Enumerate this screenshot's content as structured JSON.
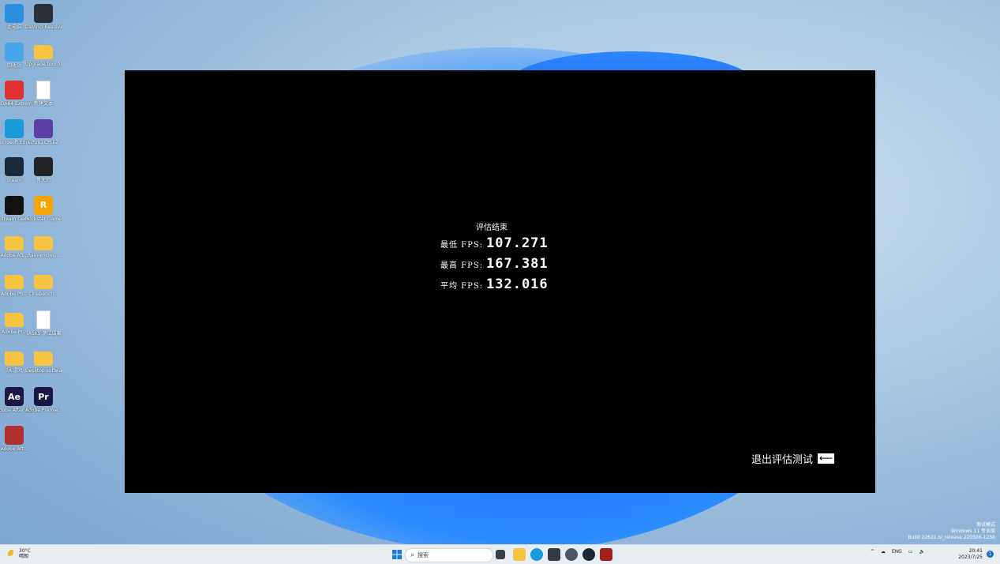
{
  "desktop_icons": [
    {
      "label": "此电脑",
      "icon": "computer-icon",
      "color": "#2b8fe0"
    },
    {
      "label": "DaVinci Resolve",
      "icon": "davinci-icon",
      "color": "#2a2f3a"
    },
    {
      "label": "回收站",
      "icon": "recycle-bin-icon",
      "color": "#4aa6e8"
    },
    {
      "label": "Upgrade tool for Premi...",
      "icon": "folder-icon",
      "color": "#f6c343"
    },
    {
      "label": "AIDA64 Extreme",
      "icon": "aida-icon",
      "color": "#d33"
    },
    {
      "label": "新建文本",
      "icon": "file-icon",
      "color": "#ffffff"
    },
    {
      "label": "Microsoft Edge",
      "icon": "edge-icon",
      "color": "#1a9bd7"
    },
    {
      "label": "CPUID CPU-Z",
      "icon": "cpuz-icon",
      "color": "#5b3fa6"
    },
    {
      "label": "Steam",
      "icon": "steam-icon",
      "color": "#1b2838"
    },
    {
      "label": "鲁大师",
      "icon": "ludashi-icon",
      "color": "#222"
    },
    {
      "label": "Stream Deck",
      "icon": "streamdeck-icon",
      "color": "#111"
    },
    {
      "label": "Rockstar Games...",
      "icon": "rockstar-icon",
      "color": "#f5a400"
    },
    {
      "label": "Adobe Aft...",
      "icon": "folder-icon",
      "color": "#f6c343"
    },
    {
      "label": "Rain-enclos...",
      "icon": "folder-icon",
      "color": "#f6c343"
    },
    {
      "label": "Adobe Ph...",
      "icon": "folder-icon",
      "color": "#f6c343"
    },
    {
      "label": "Cinebench...",
      "icon": "folder-icon",
      "color": "#f6c343"
    },
    {
      "label": "Adobe Pr...",
      "icon": "folder-icon",
      "color": "#f6c343"
    },
    {
      "label": "TASKS 测试结果",
      "icon": "file-icon",
      "color": "#ffffff"
    },
    {
      "label": "3A 游戏",
      "icon": "folder-icon",
      "color": "#f6c343"
    },
    {
      "label": "Desktop software",
      "icon": "folder-icon",
      "color": "#f6c343"
    },
    {
      "label": "Adobe After Effects 2023",
      "icon": "after-effects-icon",
      "color": "#1f1545"
    },
    {
      "label": "Adobe Premie...",
      "icon": "premiere-icon",
      "color": "#1a1643"
    },
    {
      "label": "Adobe Aft...",
      "icon": "winrar-icon",
      "color": "#b03030"
    }
  ],
  "window": {
    "title": "评估结束",
    "rows": [
      {
        "label": "最低 FPS:",
        "value": "107.271"
      },
      {
        "label": "最高 FPS:",
        "value": "167.381"
      },
      {
        "label": "平均 FPS:",
        "value": "132.016"
      }
    ],
    "exit_label": "退出评估测试",
    "exit_arrow": "⟵"
  },
  "watermark": {
    "line1": "测试模式",
    "line2": "Windows 11 专业版",
    "line3": "Build 22621.ni_release.220506-1250"
  },
  "taskbar": {
    "weather_temp": "30°C",
    "weather_text": "晴朗",
    "search_placeholder": "搜索",
    "search_icon": "search-icon",
    "lang": "ENG",
    "time": "20:41",
    "date": "2023/7/25",
    "notification_count": "1"
  }
}
